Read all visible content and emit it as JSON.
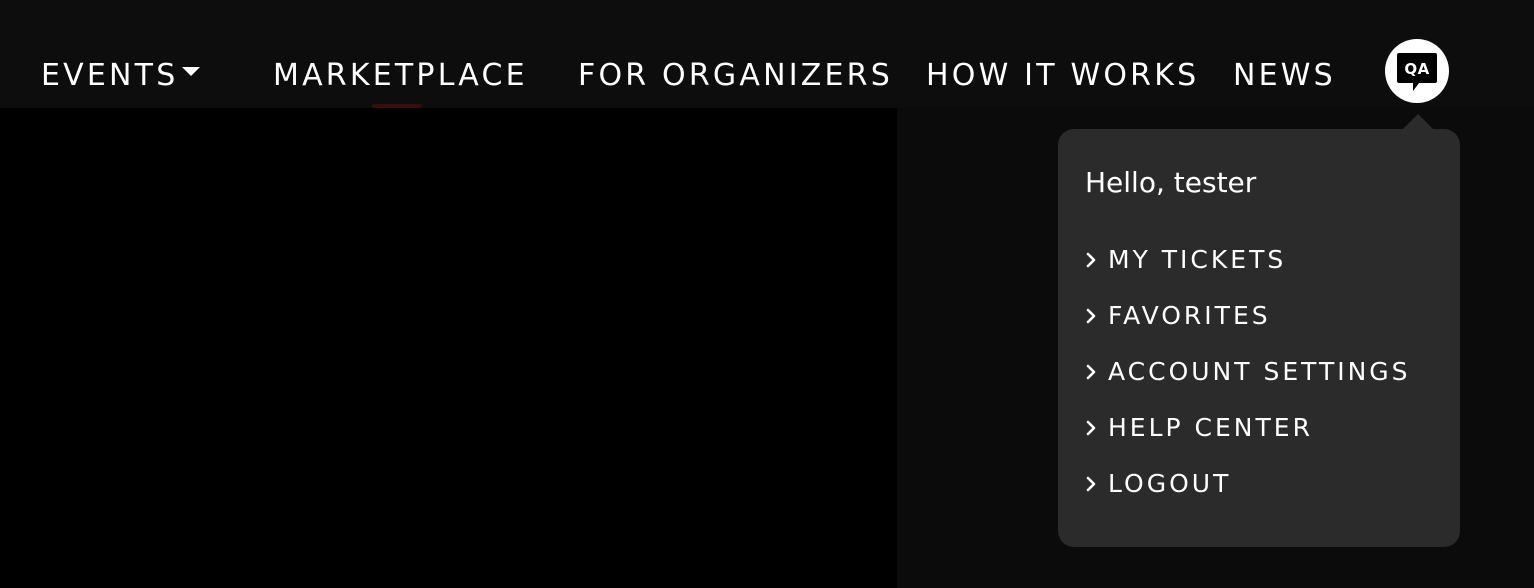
{
  "nav": {
    "events_label": "EVENTS",
    "marketplace_label": "MARKETPLACE",
    "organizers_label": "FOR ORGANIZERS",
    "how_it_works_label": "HOW IT WORKS",
    "news_label": "NEWS",
    "avatar_initials": "QA"
  },
  "user_menu": {
    "greeting": "Hello, tester",
    "items": [
      {
        "label": "MY TICKETS",
        "icon": "chevron-right-icon"
      },
      {
        "label": "FAVORITES",
        "icon": "chevron-right-icon"
      },
      {
        "label": "ACCOUNT SETTINGS",
        "icon": "chevron-right-icon"
      },
      {
        "label": "HELP CENTER",
        "icon": "chevron-right-icon"
      },
      {
        "label": "LOGOUT",
        "icon": "chevron-right-icon"
      }
    ]
  },
  "colors": {
    "background": "#0b0a0b",
    "hero_left": "#000000",
    "dropdown_bg": "#2b2b2c",
    "text": "#ffffff",
    "avatar_bg": "#ffffff",
    "avatar_fg": "#000000"
  }
}
